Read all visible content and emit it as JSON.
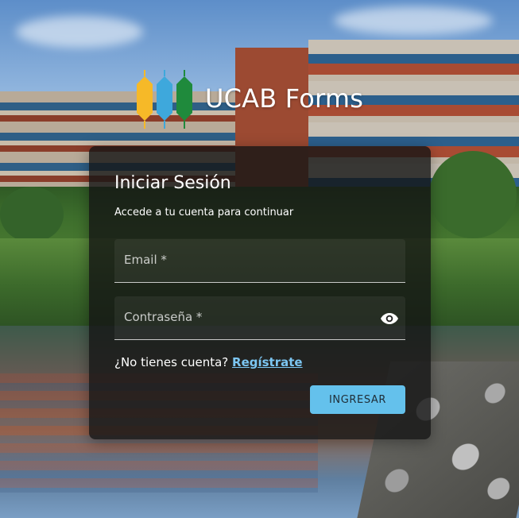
{
  "brand": {
    "name": "UCAB Forms",
    "logo_icon": "ucab-forms-logo",
    "colors": {
      "yellow": "#f6b928",
      "blue": "#3ea8dc",
      "green": "#1f8a3c"
    }
  },
  "login": {
    "title": "Iniciar Sesión",
    "subtitle": "Accede a tu cuenta para continuar",
    "email_label": "Email *",
    "password_label": "Contraseña *",
    "password_toggle_icon": "eye-icon",
    "register_prompt": "¿No tienes cuenta?",
    "register_link": "Regístrate",
    "submit_label": "INGRESAR",
    "accent_color": "#64c1ec"
  }
}
